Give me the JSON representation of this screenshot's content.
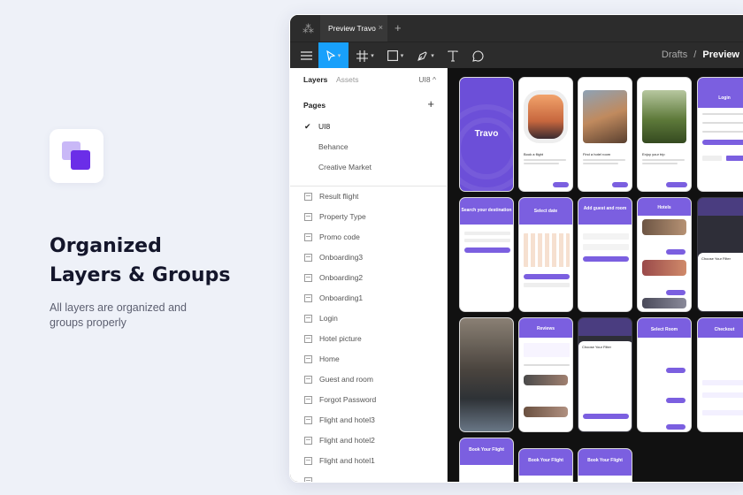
{
  "promo": {
    "headline_line1": "Organized",
    "headline_line2": "Layers & Groups",
    "subtext_line1": "All layers are organized and",
    "subtext_line2": "groups properly",
    "accent_light": "#c9b8f7",
    "accent_dark": "#6b2ee8"
  },
  "window": {
    "tab_title": "Preview Travo",
    "tab_close_icon": "×",
    "new_tab_icon": "+",
    "breadcrumb_parent": "Drafts",
    "breadcrumb_separator": "/",
    "breadcrumb_current": "Preview",
    "tool_accent": "#18a0fb"
  },
  "toolbar": {
    "tools": [
      "menu-icon",
      "move-icon",
      "frame-icon",
      "shape-icon",
      "pen-icon",
      "text-icon",
      "comment-icon"
    ]
  },
  "panel": {
    "tab_layers": "Layers",
    "tab_assets": "Assets",
    "current_page": "UI8 ^",
    "pages_label": "Pages",
    "add_icon": "+",
    "pages": [
      "UI8",
      "Behance",
      "Creative Market"
    ],
    "layers": [
      "Result flight",
      "Property Type",
      "Promo code",
      "Onboarding3",
      "Onboarding2",
      "Onboarding1",
      "Login",
      "Hotel picture",
      "Home",
      "Guest and room",
      "Forgot Password",
      "Flight and hotel3",
      "Flight and hotel2",
      "Flight and hotel1"
    ]
  },
  "canvas": {
    "brand": "Travo",
    "onboarding": [
      "Book a flight",
      "Find a hotel room",
      "Enjoy your trip"
    ],
    "login": "Login",
    "search": "Search your destination",
    "select_date": "Select date",
    "guest_room": "Add guest and room",
    "hotels": "Hotels",
    "reviews": "Reviews",
    "filter": "Choose Your Filter",
    "select_room": "Select Room",
    "checkout": "Checkout",
    "book_flight": "Book Your Flight",
    "brand_color": "#6c4fd8"
  }
}
